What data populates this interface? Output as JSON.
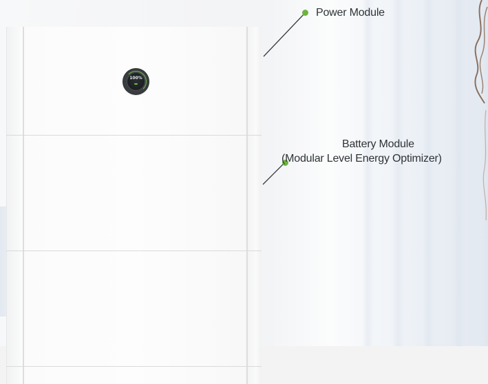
{
  "callouts": {
    "power_module": "Power Module",
    "battery_module_title": "Battery Module",
    "battery_module_subtitle": "(Modular Level Energy Optimizer)"
  },
  "display": {
    "value": "100%"
  },
  "colors": {
    "accent": "#6cb43f",
    "text": "#2f3336",
    "cabinet": "#fbfbfb",
    "display_bezel": "#3a3d40"
  },
  "icons": [
    "callout-dot-icon",
    "hair-decoration"
  ]
}
